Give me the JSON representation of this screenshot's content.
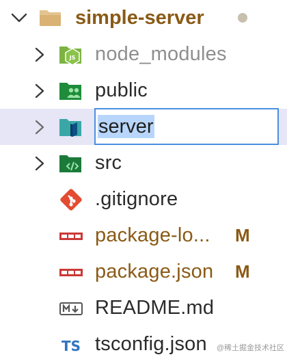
{
  "explorer": {
    "root": {
      "label": "simple-server",
      "icon": "folder-open-icon"
    },
    "items": [
      {
        "label": "node_modules",
        "icon": "folder-node-icon",
        "type": "folder"
      },
      {
        "label": "public",
        "icon": "folder-public-icon",
        "type": "folder"
      },
      {
        "label": "server",
        "icon": "folder-server-icon",
        "type": "folder",
        "renaming": true
      },
      {
        "label": "src",
        "icon": "folder-src-icon",
        "type": "folder"
      },
      {
        "label": ".gitignore",
        "icon": "git-icon",
        "type": "file"
      },
      {
        "label": "package-lo...",
        "icon": "npm-icon",
        "type": "file",
        "badge": "M"
      },
      {
        "label": "package.json",
        "icon": "npm-icon",
        "type": "file",
        "badge": "M"
      },
      {
        "label": "README.md",
        "icon": "markdown-icon",
        "type": "file"
      },
      {
        "label": "tsconfig.json",
        "icon": "typescript-icon",
        "type": "file"
      }
    ]
  },
  "watermark": "@稀土掘金技术社区"
}
